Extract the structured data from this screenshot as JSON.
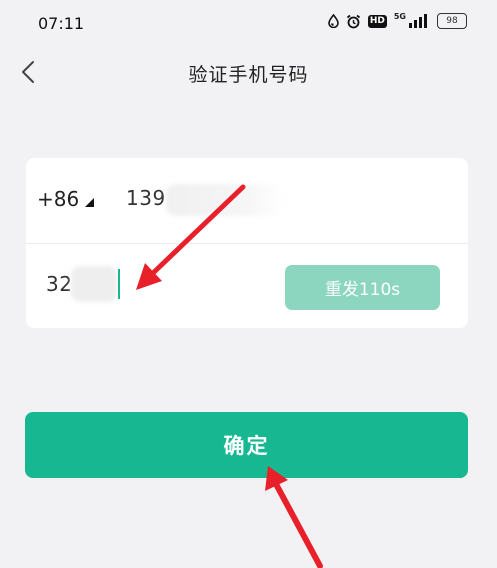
{
  "status_bar": {
    "time": "07:11",
    "network_label": "5G",
    "battery": "98"
  },
  "nav": {
    "title": "验证手机号码"
  },
  "form": {
    "country_code": "+86",
    "phone_value": "139",
    "code_value": "32",
    "resend_label": "重发110s"
  },
  "confirm_label": "确定",
  "colors": {
    "accent": "#17b891",
    "accent_disabled": "#8cd6c0",
    "annotation_arrow": "#e8202a"
  },
  "icons": {
    "back": "chevron-left-icon",
    "country_caret": "caret-down-icon"
  }
}
